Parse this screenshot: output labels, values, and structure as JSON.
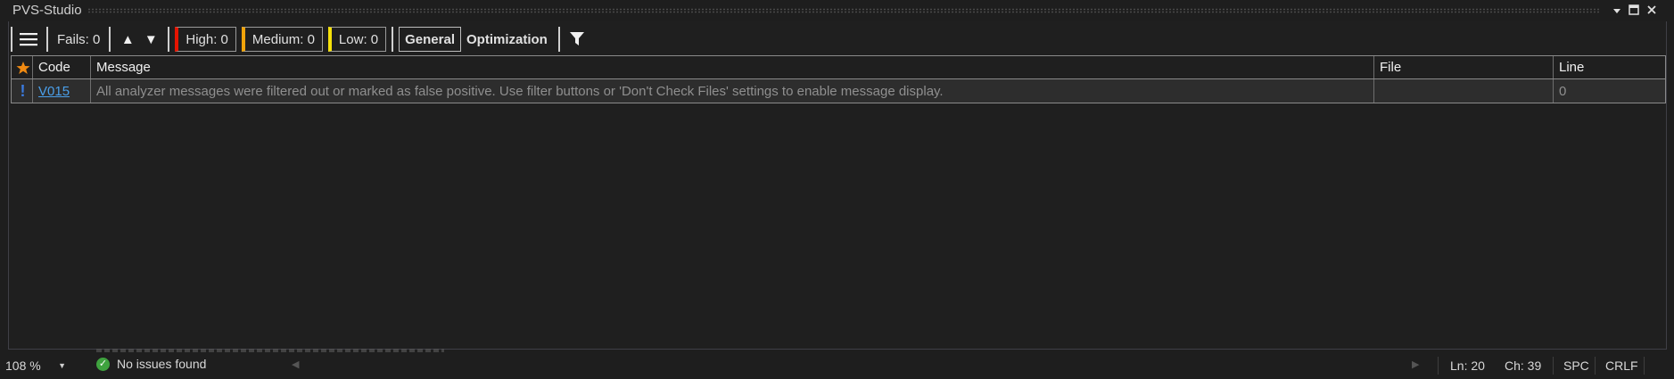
{
  "window": {
    "title": "PVS-Studio",
    "controls": [
      "dropdown-icon",
      "maximize-icon",
      "close-icon"
    ]
  },
  "toolbar": {
    "menu_icon": "hamburger-menu-icon",
    "fails_label": "Fails: 0",
    "up_arrow": "▲",
    "down_arrow": "▼",
    "high_label": "High: 0",
    "medium_label": "Medium: 0",
    "low_label": "Low: 0",
    "general_label": "General",
    "optimization_label": "Optimization",
    "filter_icon": "funnel-icon"
  },
  "grid": {
    "columns": [
      "Code",
      "Message",
      "File",
      "Line"
    ],
    "rows": [
      {
        "code": "V015",
        "message": "All analyzer messages were filtered out or marked as false positive. Use filter buttons or 'Don't Check Files' settings to enable message display.",
        "file": "",
        "line": "0"
      }
    ]
  },
  "statusbar": {
    "zoom": "108 %",
    "issues": "No issues found",
    "ln": "Ln: 20",
    "ch": "Ch: 39",
    "spc": "SPC",
    "crlf": "CRLF"
  },
  "colors": {
    "high": "#e51400",
    "medium": "#f0a30a",
    "low": "#f5e10a",
    "link": "#4a9fea",
    "ok": "#3fa33f"
  }
}
